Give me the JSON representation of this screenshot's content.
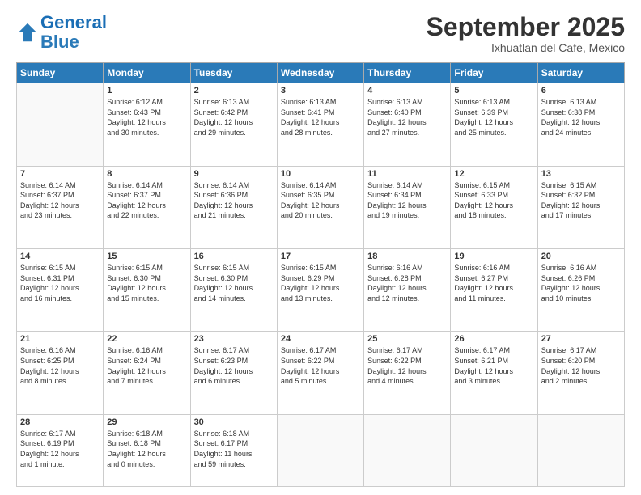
{
  "logo": {
    "line1": "General",
    "line2": "Blue"
  },
  "title": "September 2025",
  "location": "Ixhuatlan del Cafe, Mexico",
  "weekdays": [
    "Sunday",
    "Monday",
    "Tuesday",
    "Wednesday",
    "Thursday",
    "Friday",
    "Saturday"
  ],
  "weeks": [
    [
      {
        "day": "",
        "info": ""
      },
      {
        "day": "1",
        "info": "Sunrise: 6:12 AM\nSunset: 6:43 PM\nDaylight: 12 hours\nand 30 minutes."
      },
      {
        "day": "2",
        "info": "Sunrise: 6:13 AM\nSunset: 6:42 PM\nDaylight: 12 hours\nand 29 minutes."
      },
      {
        "day": "3",
        "info": "Sunrise: 6:13 AM\nSunset: 6:41 PM\nDaylight: 12 hours\nand 28 minutes."
      },
      {
        "day": "4",
        "info": "Sunrise: 6:13 AM\nSunset: 6:40 PM\nDaylight: 12 hours\nand 27 minutes."
      },
      {
        "day": "5",
        "info": "Sunrise: 6:13 AM\nSunset: 6:39 PM\nDaylight: 12 hours\nand 25 minutes."
      },
      {
        "day": "6",
        "info": "Sunrise: 6:13 AM\nSunset: 6:38 PM\nDaylight: 12 hours\nand 24 minutes."
      }
    ],
    [
      {
        "day": "7",
        "info": "Sunrise: 6:14 AM\nSunset: 6:37 PM\nDaylight: 12 hours\nand 23 minutes."
      },
      {
        "day": "8",
        "info": "Sunrise: 6:14 AM\nSunset: 6:37 PM\nDaylight: 12 hours\nand 22 minutes."
      },
      {
        "day": "9",
        "info": "Sunrise: 6:14 AM\nSunset: 6:36 PM\nDaylight: 12 hours\nand 21 minutes."
      },
      {
        "day": "10",
        "info": "Sunrise: 6:14 AM\nSunset: 6:35 PM\nDaylight: 12 hours\nand 20 minutes."
      },
      {
        "day": "11",
        "info": "Sunrise: 6:14 AM\nSunset: 6:34 PM\nDaylight: 12 hours\nand 19 minutes."
      },
      {
        "day": "12",
        "info": "Sunrise: 6:15 AM\nSunset: 6:33 PM\nDaylight: 12 hours\nand 18 minutes."
      },
      {
        "day": "13",
        "info": "Sunrise: 6:15 AM\nSunset: 6:32 PM\nDaylight: 12 hours\nand 17 minutes."
      }
    ],
    [
      {
        "day": "14",
        "info": "Sunrise: 6:15 AM\nSunset: 6:31 PM\nDaylight: 12 hours\nand 16 minutes."
      },
      {
        "day": "15",
        "info": "Sunrise: 6:15 AM\nSunset: 6:30 PM\nDaylight: 12 hours\nand 15 minutes."
      },
      {
        "day": "16",
        "info": "Sunrise: 6:15 AM\nSunset: 6:30 PM\nDaylight: 12 hours\nand 14 minutes."
      },
      {
        "day": "17",
        "info": "Sunrise: 6:15 AM\nSunset: 6:29 PM\nDaylight: 12 hours\nand 13 minutes."
      },
      {
        "day": "18",
        "info": "Sunrise: 6:16 AM\nSunset: 6:28 PM\nDaylight: 12 hours\nand 12 minutes."
      },
      {
        "day": "19",
        "info": "Sunrise: 6:16 AM\nSunset: 6:27 PM\nDaylight: 12 hours\nand 11 minutes."
      },
      {
        "day": "20",
        "info": "Sunrise: 6:16 AM\nSunset: 6:26 PM\nDaylight: 12 hours\nand 10 minutes."
      }
    ],
    [
      {
        "day": "21",
        "info": "Sunrise: 6:16 AM\nSunset: 6:25 PM\nDaylight: 12 hours\nand 8 minutes."
      },
      {
        "day": "22",
        "info": "Sunrise: 6:16 AM\nSunset: 6:24 PM\nDaylight: 12 hours\nand 7 minutes."
      },
      {
        "day": "23",
        "info": "Sunrise: 6:17 AM\nSunset: 6:23 PM\nDaylight: 12 hours\nand 6 minutes."
      },
      {
        "day": "24",
        "info": "Sunrise: 6:17 AM\nSunset: 6:22 PM\nDaylight: 12 hours\nand 5 minutes."
      },
      {
        "day": "25",
        "info": "Sunrise: 6:17 AM\nSunset: 6:22 PM\nDaylight: 12 hours\nand 4 minutes."
      },
      {
        "day": "26",
        "info": "Sunrise: 6:17 AM\nSunset: 6:21 PM\nDaylight: 12 hours\nand 3 minutes."
      },
      {
        "day": "27",
        "info": "Sunrise: 6:17 AM\nSunset: 6:20 PM\nDaylight: 12 hours\nand 2 minutes."
      }
    ],
    [
      {
        "day": "28",
        "info": "Sunrise: 6:17 AM\nSunset: 6:19 PM\nDaylight: 12 hours\nand 1 minute."
      },
      {
        "day": "29",
        "info": "Sunrise: 6:18 AM\nSunset: 6:18 PM\nDaylight: 12 hours\nand 0 minutes."
      },
      {
        "day": "30",
        "info": "Sunrise: 6:18 AM\nSunset: 6:17 PM\nDaylight: 11 hours\nand 59 minutes."
      },
      {
        "day": "",
        "info": ""
      },
      {
        "day": "",
        "info": ""
      },
      {
        "day": "",
        "info": ""
      },
      {
        "day": "",
        "info": ""
      }
    ]
  ]
}
